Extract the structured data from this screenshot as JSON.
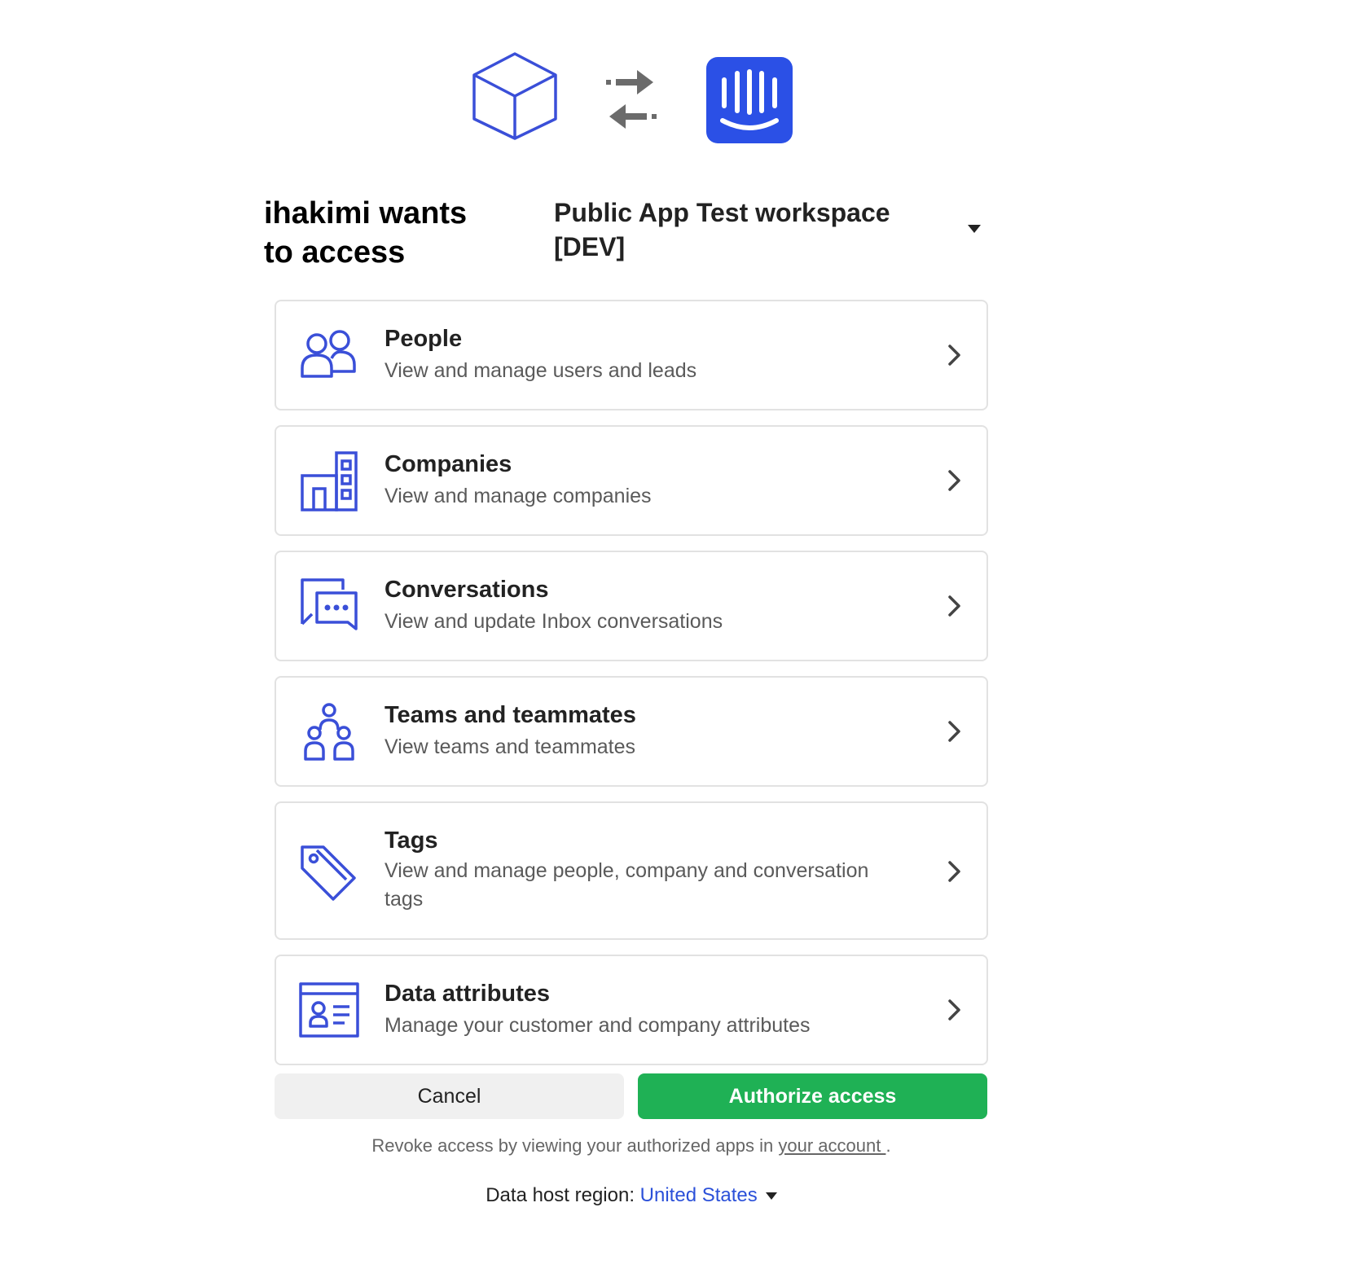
{
  "header": {
    "headline": "ihakimi wants to access",
    "workspace_name": "Public App Test workspace [DEV]"
  },
  "colors": {
    "icon_blue": "#3a4fd8",
    "intercom_blue": "#2b50e6",
    "authorize_green": "#1fb155",
    "link_blue": "#2b50d9"
  },
  "scopes": [
    {
      "title": "People",
      "description": "View and manage users and leads",
      "icon": "people-icon"
    },
    {
      "title": "Companies",
      "description": "View and manage companies",
      "icon": "companies-icon"
    },
    {
      "title": "Conversations",
      "description": "View and update Inbox conversations",
      "icon": "conversations-icon"
    },
    {
      "title": "Teams and teammates",
      "description": "View teams and teammates",
      "icon": "teams-icon"
    },
    {
      "title": "Tags",
      "description": "View and manage people, company and conversation tags",
      "icon": "tag-icon"
    },
    {
      "title": "Data attributes",
      "description": "Manage your customer and company attributes",
      "icon": "data-attributes-icon"
    }
  ],
  "actions": {
    "cancel_label": "Cancel",
    "authorize_label": "Authorize access"
  },
  "footer": {
    "revoke_prefix": "Revoke access by viewing your authorized apps in ",
    "revoke_link": "your account ",
    "revoke_suffix": ".",
    "region_label": "Data host region:",
    "region_value": "United States"
  }
}
